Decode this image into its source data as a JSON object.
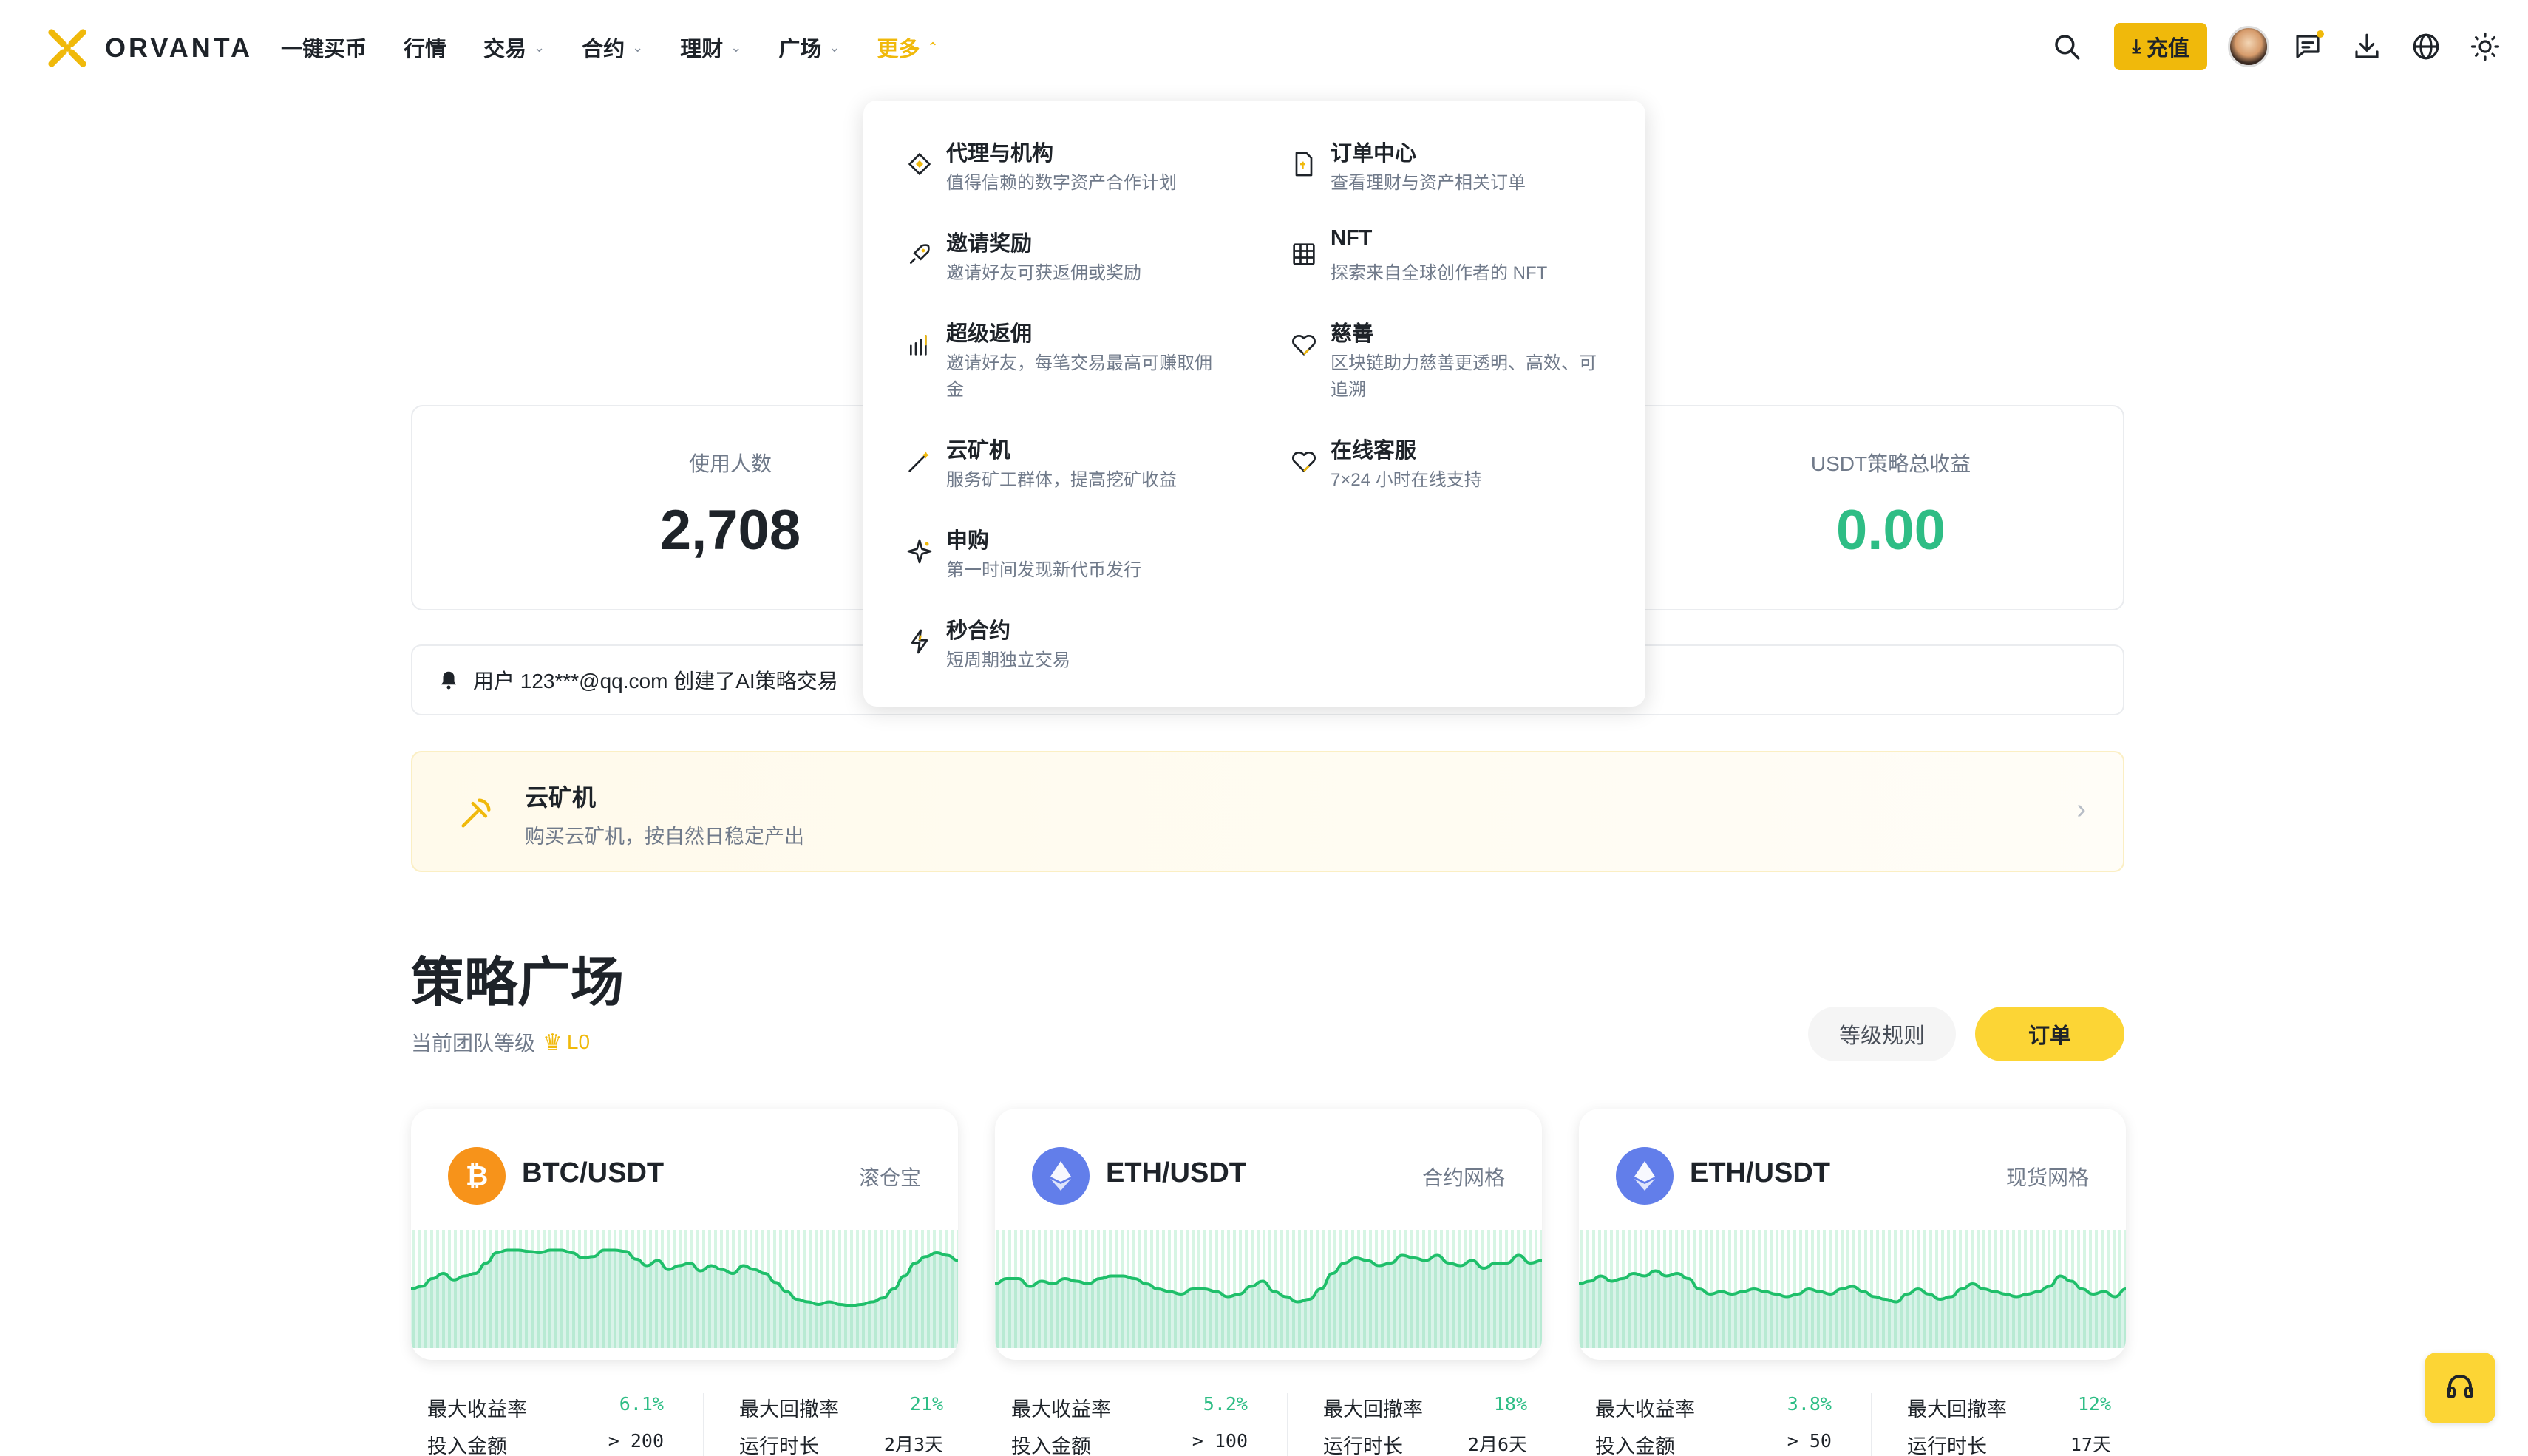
{
  "header": {
    "brand": "ORVANTA",
    "nav": [
      {
        "label": "一键买币",
        "has_chevron": false
      },
      {
        "label": "行情",
        "has_chevron": false
      },
      {
        "label": "交易",
        "has_chevron": true
      },
      {
        "label": "合约",
        "has_chevron": true
      },
      {
        "label": "理财",
        "has_chevron": true
      },
      {
        "label": "广场",
        "has_chevron": true
      },
      {
        "label": "更多",
        "has_chevron": true,
        "active": true
      }
    ],
    "deposit_label": "充值",
    "icons": [
      "search-icon",
      "avatar",
      "message-icon",
      "download-icon",
      "globe-icon",
      "sun-icon"
    ]
  },
  "more_menu": {
    "left": [
      {
        "title": "代理与机构",
        "desc": "值得信赖的数字资产合作计划",
        "icon": "diamond-icon"
      },
      {
        "title": "邀请奖励",
        "desc": "邀请好友可获返佣或奖励",
        "icon": "rocket-icon"
      },
      {
        "title": "超级返佣",
        "desc": "邀请好友，每笔交易最高可赚取佣金",
        "icon": "bar-chart-icon"
      },
      {
        "title": "云矿机",
        "desc": "服务矿工群体，提高挖矿收益",
        "icon": "wand-icon"
      },
      {
        "title": "申购",
        "desc": "第一时间发现新代币发行",
        "icon": "sparkle-icon"
      },
      {
        "title": "秒合约",
        "desc": "短周期独立交易",
        "icon": "lightning-icon"
      }
    ],
    "right": [
      {
        "title": "订单中心",
        "desc": "查看理财与资产相关订单",
        "icon": "document-icon"
      },
      {
        "title": "NFT",
        "desc": "探索来自全球创作者的 NFT",
        "icon": "grid-icon"
      },
      {
        "title": "慈善",
        "desc": "区块链助力慈善更透明、高效、可追溯",
        "icon": "heart-icon"
      },
      {
        "title": "在线客服",
        "desc": "7×24 小时在线支持",
        "icon": "heart-support-icon"
      }
    ]
  },
  "stats": {
    "users_label": "使用人数",
    "users_value": "2,708",
    "profit_label": "USDT策略总收益",
    "profit_value": "0.00"
  },
  "notice": {
    "text": "用户 123***@qq.com 创建了AI策略交易"
  },
  "mining": {
    "title": "云矿机",
    "subtitle": "购买云矿机，按自然日稳定产出"
  },
  "strategy": {
    "title": "策略广场",
    "level_label": "当前团队等级",
    "level_value": "L0",
    "rules_button": "等级规则",
    "orders_button": "订单"
  },
  "cards": [
    {
      "pair": "BTC/USDT",
      "type": "滚仓宝",
      "coin": "btc",
      "coin_color": "#f7931a",
      "max_return_label": "最大收益率",
      "max_return": "6.1%",
      "max_drawdown_label": "最大回撤率",
      "max_drawdown": "21%",
      "invest_label": "投入金额",
      "invest": "> 200",
      "runtime_label": "运行时长",
      "runtime": "2月3天",
      "sparkline": [
        40,
        42,
        48,
        52,
        47,
        50,
        52,
        60,
        68,
        70,
        70,
        69,
        68,
        70,
        70,
        68,
        64,
        65,
        70,
        70,
        69,
        63,
        58,
        62,
        55,
        58,
        60,
        54,
        58,
        55,
        52,
        58,
        55,
        52,
        45,
        38,
        32,
        30,
        28,
        30,
        28,
        27,
        28,
        30,
        33,
        40,
        50,
        60,
        65,
        68,
        66,
        62
      ]
    },
    {
      "pair": "ETH/USDT",
      "type": "合约网格",
      "coin": "eth",
      "coin_color": "#627eea",
      "max_return_label": "最大收益率",
      "max_return": "5.2%",
      "max_drawdown_label": "最大回撤率",
      "max_drawdown": "18%",
      "invest_label": "投入金额",
      "invest": "> 100",
      "runtime_label": "运行时长",
      "runtime": "2月6天",
      "sparkline": [
        44,
        48,
        48,
        42,
        46,
        44,
        48,
        46,
        44,
        48,
        50,
        50,
        48,
        44,
        40,
        38,
        36,
        40,
        40,
        38,
        34,
        36,
        42,
        46,
        38,
        34,
        30,
        32,
        40,
        52,
        60,
        64,
        62,
        58,
        60,
        66,
        64,
        62,
        66,
        60,
        58,
        62,
        56,
        60,
        60,
        66,
        60,
        62
      ]
    },
    {
      "pair": "ETH/USDT",
      "type": "现货网格",
      "coin": "eth",
      "coin_color": "#627eea",
      "max_return_label": "最大收益率",
      "max_return": "3.8%",
      "max_drawdown_label": "最大回撤率",
      "max_drawdown": "12%",
      "invest_label": "投入金额",
      "invest": "> 50",
      "runtime_label": "运行时长",
      "runtime": "17天",
      "sparkline": [
        44,
        46,
        50,
        46,
        48,
        52,
        50,
        54,
        50,
        52,
        48,
        40,
        36,
        38,
        36,
        38,
        40,
        38,
        36,
        34,
        36,
        40,
        38,
        36,
        40,
        42,
        38,
        34,
        32,
        30,
        36,
        40,
        36,
        32,
        34,
        40,
        44,
        40,
        38,
        36,
        34,
        36,
        38,
        42,
        50,
        46,
        40,
        36,
        38,
        34,
        40
      ]
    }
  ]
}
